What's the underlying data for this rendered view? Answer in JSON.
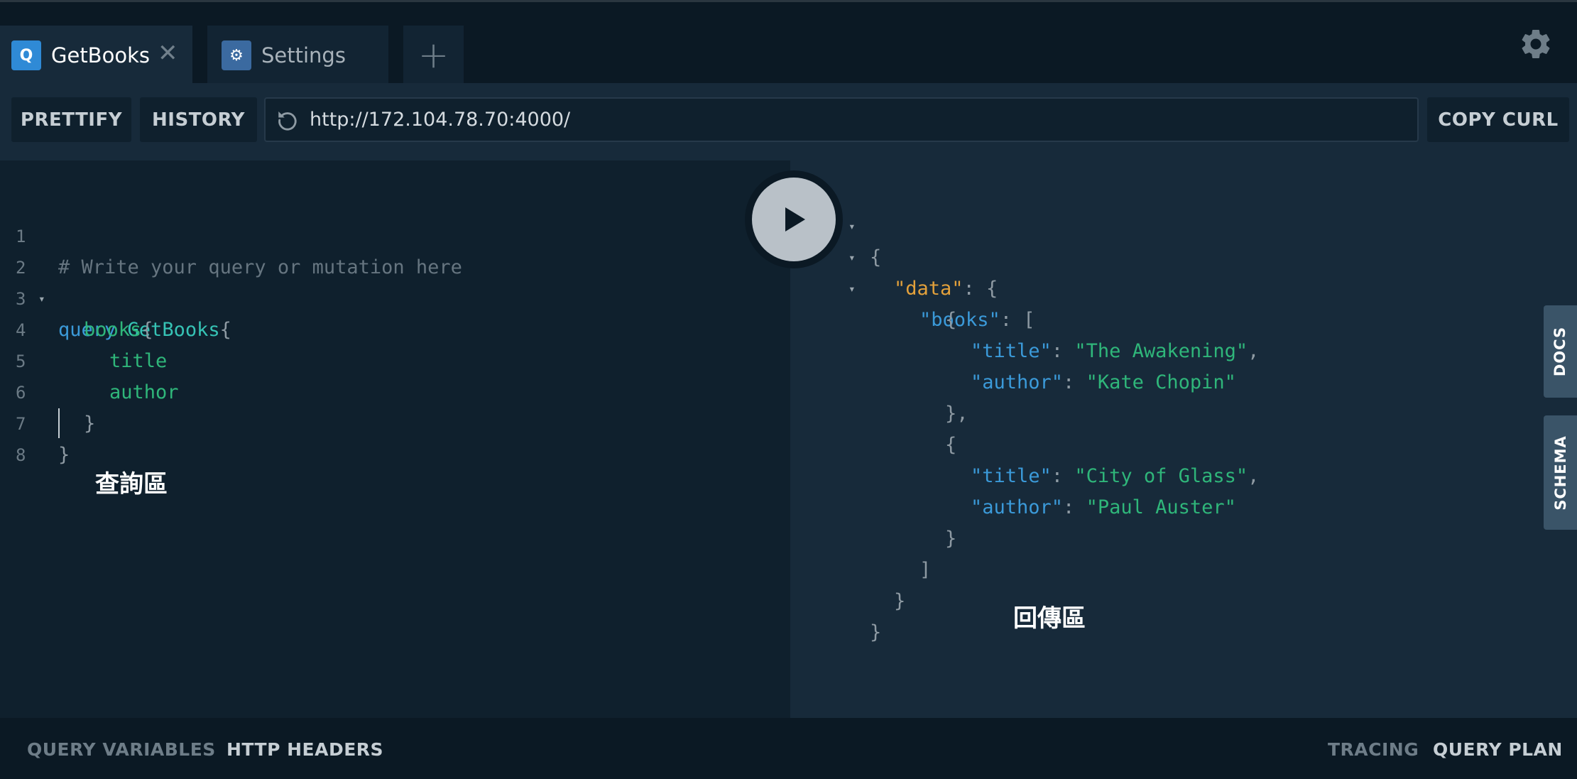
{
  "tabs": [
    {
      "badge": "Q",
      "label": "GetBooks",
      "close": "✕",
      "active": true
    },
    {
      "badge": "⚙",
      "label": "Settings",
      "active": false
    }
  ],
  "add_tab": "+",
  "toolbar": {
    "prettify": "PRETTIFY",
    "history": "HISTORY",
    "url": "http://172.104.78.70:4000/",
    "copy_curl": "COPY CURL"
  },
  "editor": {
    "lines": [
      {
        "n": "1",
        "comment": "# Write your query or mutation here"
      },
      {
        "n": "2",
        "kw": "query",
        "name": "GetBooks",
        "brace": "{"
      },
      {
        "n": "3",
        "field": "books",
        "brace": "{"
      },
      {
        "n": "4",
        "field": "title"
      },
      {
        "n": "5",
        "field": "author"
      },
      {
        "n": "6",
        "brace": "}"
      },
      {
        "n": "7",
        "brace": "}"
      },
      {
        "n": "8"
      }
    ],
    "annotation": "查詢區"
  },
  "result": {
    "books": [
      {
        "title": "The Awakening",
        "author": "Kate Chopin"
      },
      {
        "title": "City of Glass",
        "author": "Paul Auster"
      }
    ],
    "keys": {
      "data": "\"data\"",
      "books": "\"books\"",
      "title": "\"title\"",
      "author": "\"author\""
    },
    "annotation": "回傳區"
  },
  "side_tabs": {
    "docs": "DOCS",
    "schema": "SCHEMA"
  },
  "bottom": {
    "query_variables": "QUERY VARIABLES",
    "http_headers": "HTTP HEADERS",
    "tracing": "TRACING",
    "query_plan": "QUERY PLAN"
  },
  "colors": {
    "background": "#0f202d",
    "panel": "#172a3a",
    "accent_blue": "#2f8ad6",
    "string_green": "#2fb67a",
    "key_orange": "#e3a13b"
  }
}
